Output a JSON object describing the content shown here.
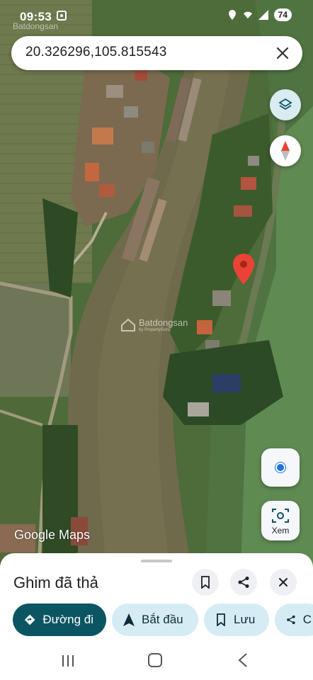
{
  "status_bar": {
    "time": "09:53",
    "battery": "74"
  },
  "watermark": {
    "brand": "Batdongsan",
    "sub": "by PropertyGuru"
  },
  "search": {
    "value": "20.326296,105.815543"
  },
  "map": {
    "logo": "Google Maps",
    "lens_label": "Xem",
    "pin_color": "#ea4335"
  },
  "sheet": {
    "title": "Ghim đã thả",
    "actions": [
      {
        "label": "Đường đi",
        "icon": "directions-icon"
      },
      {
        "label": "Bắt đầu",
        "icon": "navigation-arrow-icon"
      },
      {
        "label": "Lưu",
        "icon": "bookmark-icon"
      },
      {
        "label": "C",
        "icon": "share-icon"
      }
    ]
  },
  "colors": {
    "primary_chip": "#0b5563",
    "secondary_chip": "#d5ecf4",
    "accent_blue": "#1a73e8"
  }
}
